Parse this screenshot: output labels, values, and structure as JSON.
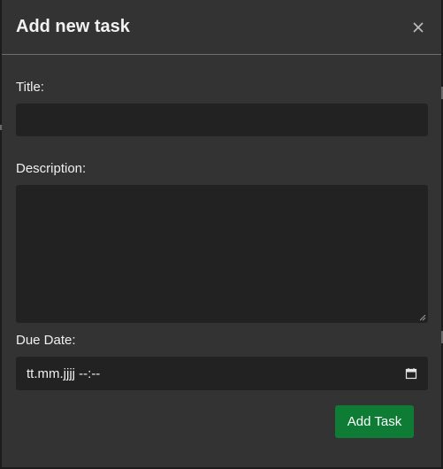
{
  "modal": {
    "title": "Add new task",
    "close_icon": "close-icon"
  },
  "form": {
    "title_label": "Title:",
    "title_value": "",
    "description_label": "Description:",
    "description_value": "",
    "due_date_label": "Due Date:",
    "due_date_value": "tt.mm.jjjj --:--",
    "calendar_icon": "calendar-icon",
    "submit_label": "Add Task"
  },
  "colors": {
    "modal_bg": "#333333",
    "input_bg": "#222222",
    "submit_bg": "#0e7c35",
    "text": "#f0f0f0"
  }
}
